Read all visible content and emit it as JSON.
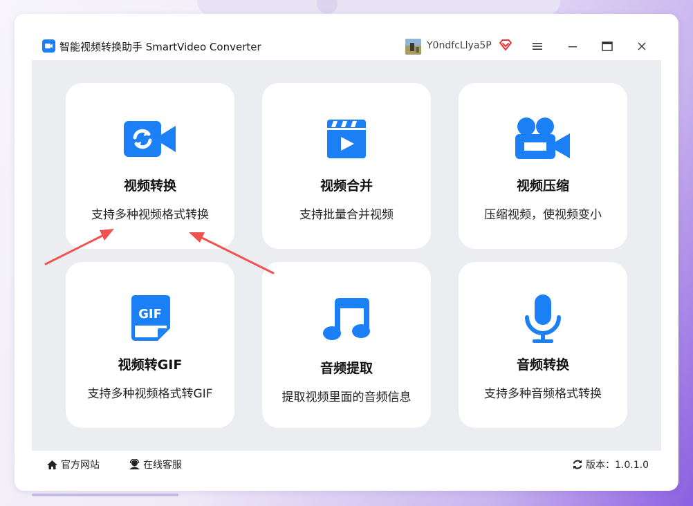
{
  "window": {
    "title": "智能视频转换助手 SmartVideo Converter",
    "username": "Y0ndfcLlya5P"
  },
  "cards": [
    {
      "title": "视频转换",
      "desc": "支持多种视频格式转换",
      "icon": "video-convert-icon"
    },
    {
      "title": "视频合并",
      "desc": "支持批量合并视频",
      "icon": "clapperboard-icon"
    },
    {
      "title": "视频压缩",
      "desc": "压缩视频，使视频变小",
      "icon": "video-camera-icon"
    },
    {
      "title": "视频转GIF",
      "desc": "支持多种视频格式转GIF",
      "icon": "gif-file-icon"
    },
    {
      "title": "音频提取",
      "desc": "提取视频里面的音频信息",
      "icon": "music-note-icon"
    },
    {
      "title": "音频转换",
      "desc": "支持多种音频格式转换",
      "icon": "microphone-icon"
    }
  ],
  "footer": {
    "website": "官方网站",
    "support": "在线客服",
    "version": "版本：1.0.1.0"
  },
  "colors": {
    "accent": "#1b7ff5",
    "annotation_arrow": "#f0524f",
    "content_bg": "#ecedf1"
  }
}
